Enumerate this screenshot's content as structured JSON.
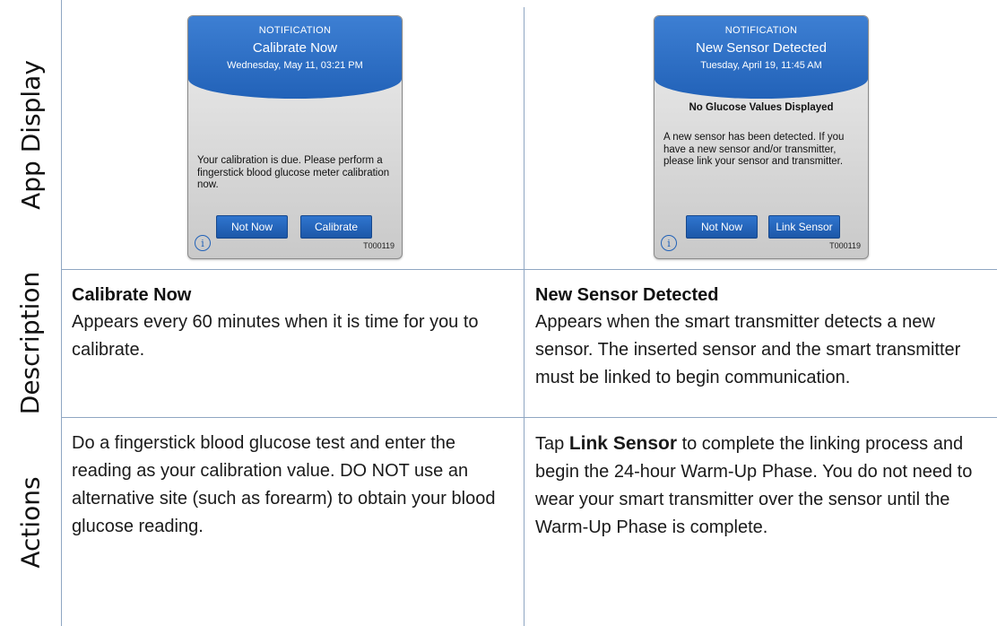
{
  "row_labels": {
    "app_display": "App Display",
    "description": "Description",
    "actions": "Actions"
  },
  "columns": [
    {
      "phone": {
        "kind": "NOTIFICATION",
        "title": "Calibrate Now",
        "date": "Wednesday, May 11, 03:21 PM",
        "subhead": "",
        "body": "Your calibration is due. Please perform a fingerstick blood glucose meter calibration now.",
        "button_left": "Not Now",
        "button_right": "Calibrate",
        "info_icon": "info-icon",
        "code": "T000119"
      },
      "description_title": "Calibrate Now",
      "description_text": "Appears every 60 minutes when it is time for you to calibrate.",
      "actions_text": "Do a fingerstick blood glucose test and enter the reading as your calibration value. DO NOT use an alternative site (such as forearm) to obtain your blood glucose reading."
    },
    {
      "phone": {
        "kind": "NOTIFICATION",
        "title": "New Sensor Detected",
        "date": "Tuesday, April 19, 11:45 AM",
        "subhead": "No Glucose Values Displayed",
        "body": "A new sensor has been detected. If you have a new sensor and/or transmitter, please link your sensor and transmitter.",
        "button_left": "Not Now",
        "button_right": "Link Sensor",
        "info_icon": "info-icon",
        "code": "T000119"
      },
      "description_title": "New Sensor Detected",
      "description_text": "Appears when the smart transmitter detects a new sensor. The inserted sensor and the smart transmitter must be linked to begin communication.",
      "actions_prefix": "Tap ",
      "actions_bold": "Link Sensor",
      "actions_suffix": " to complete the linking process and begin the 24-hour Warm-Up Phase. You do not need to wear your smart transmitter over the sensor until the Warm-Up Phase is complete."
    }
  ],
  "colors": {
    "grid_line": "#8fa6c2",
    "header_blue": "#2262b8",
    "button_blue": "#1c57a8"
  }
}
